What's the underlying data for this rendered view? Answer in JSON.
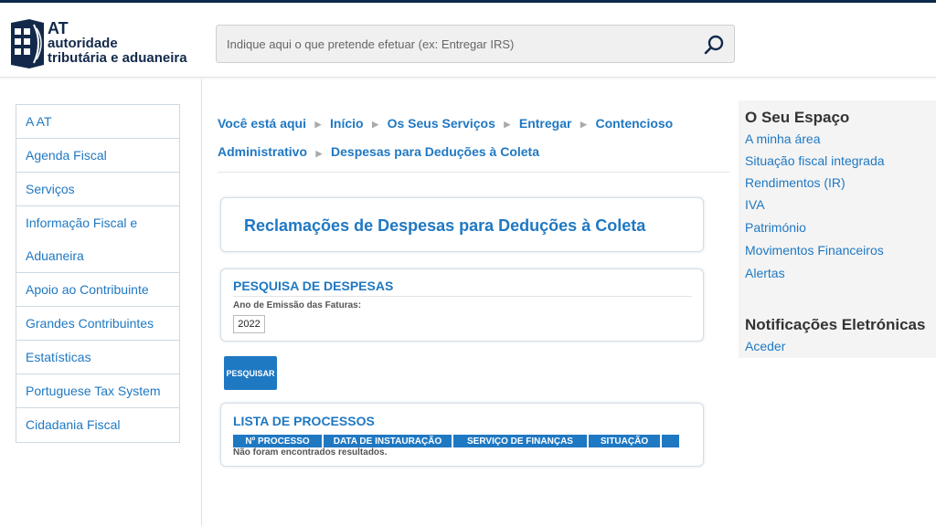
{
  "header": {
    "logo": {
      "line1": "AT",
      "line2": "autoridade",
      "line3": "tributária e aduaneira"
    },
    "search": {
      "placeholder": "Indique aqui o que pretende efetuar (ex: Entregar IRS)",
      "value": ""
    },
    "search_icon": "search-icon"
  },
  "sidebar": {
    "items": [
      {
        "label": "A AT"
      },
      {
        "label": "Agenda Fiscal"
      },
      {
        "label": "Serviços"
      },
      {
        "label_lines": [
          "Informação Fiscal e",
          "Aduaneira"
        ]
      },
      {
        "label": "Apoio ao Contribuinte"
      },
      {
        "label": "Grandes Contribuintes"
      },
      {
        "label": "Estatísticas"
      },
      {
        "label": "Portuguese Tax System"
      },
      {
        "label": "Cidadania Fiscal"
      }
    ]
  },
  "breadcrumb": {
    "intro": "Você está aqui",
    "items": [
      "Início",
      "Os Seus Serviços",
      "Entregar",
      "Contencioso Administrativo",
      "Despesas para Deduções à Coleta"
    ],
    "separator_icon": "chevron-right-icon"
  },
  "main": {
    "title": "Reclamações de Despesas para Deduções à Coleta",
    "search_section": {
      "title": "PESQUISA DE DESPESAS",
      "field_label": "Ano de Emissão das Faturas:",
      "year_value": "2022"
    },
    "search_button": "PESQUISAR",
    "list_section": {
      "title": "LISTA DE PROCESSOS",
      "columns": [
        "Nº PROCESSO",
        "DATA DE INSTAURAÇÃO",
        "SERVIÇO DE FINANÇAS",
        "SITUAÇÃO",
        ""
      ],
      "empty_message": "Não foram encontrados resultados."
    }
  },
  "right": {
    "seu_espaco": {
      "title": "O Seu Espaço",
      "links": [
        "A minha área",
        "Situação fiscal integrada",
        "Rendimentos (IR)",
        "IVA",
        "Património",
        "Movimentos Financeiros",
        "Alertas"
      ]
    },
    "notificacoes": {
      "title": "Notificações Eletrónicas",
      "links": [
        "Aceder"
      ]
    }
  },
  "colors": {
    "accent": "#1f78c2",
    "brand_dark": "#13294b"
  }
}
